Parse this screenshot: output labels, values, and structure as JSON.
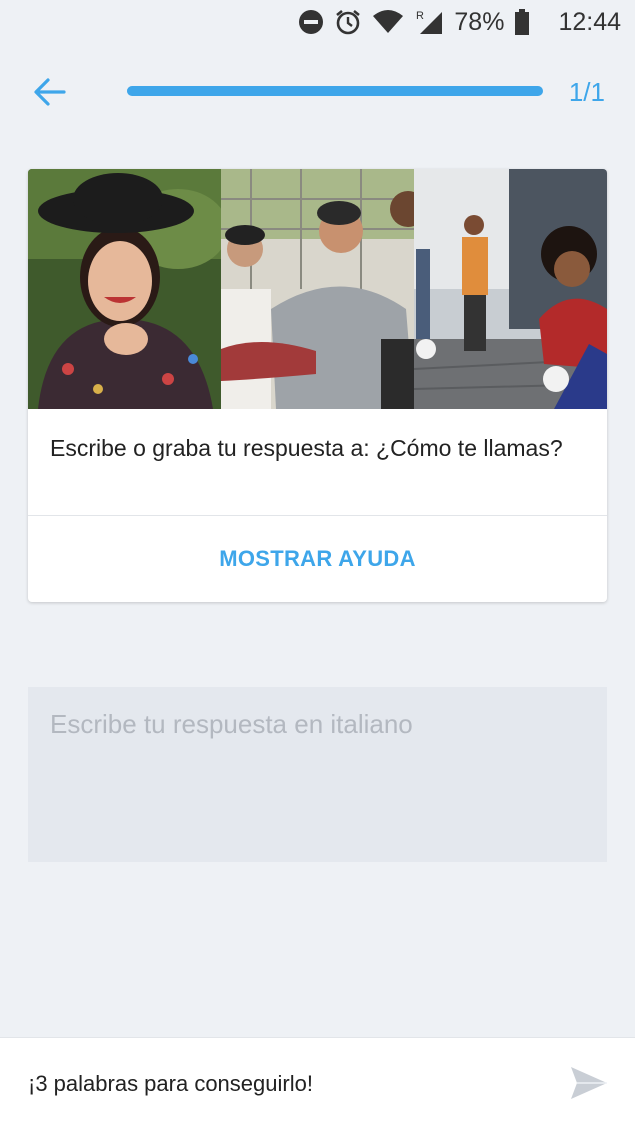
{
  "status_bar": {
    "battery_percent": "78%",
    "time": "12:44",
    "icons": [
      "do-not-disturb-icon",
      "alarm-icon",
      "wifi-icon",
      "signal-roaming-icon",
      "battery-icon"
    ]
  },
  "header": {
    "back_icon": "arrow-left-icon",
    "progress": {
      "current": 1,
      "total": 1,
      "fraction": 1.0,
      "label": "1/1"
    },
    "accent_color": "#3ea6ea"
  },
  "card": {
    "photos": [
      "portrait-woman-hat",
      "friends-group",
      "street-football"
    ],
    "prompt": "Escribe o graba tu respuesta a: ¿Cómo te llamas?",
    "help_label": "MOSTRAR AYUDA"
  },
  "answer": {
    "placeholder": "Escribe tu respuesta en italiano",
    "value": ""
  },
  "footer": {
    "hint": "¡3 palabras para conseguirlo!",
    "send_icon": "send-icon"
  }
}
